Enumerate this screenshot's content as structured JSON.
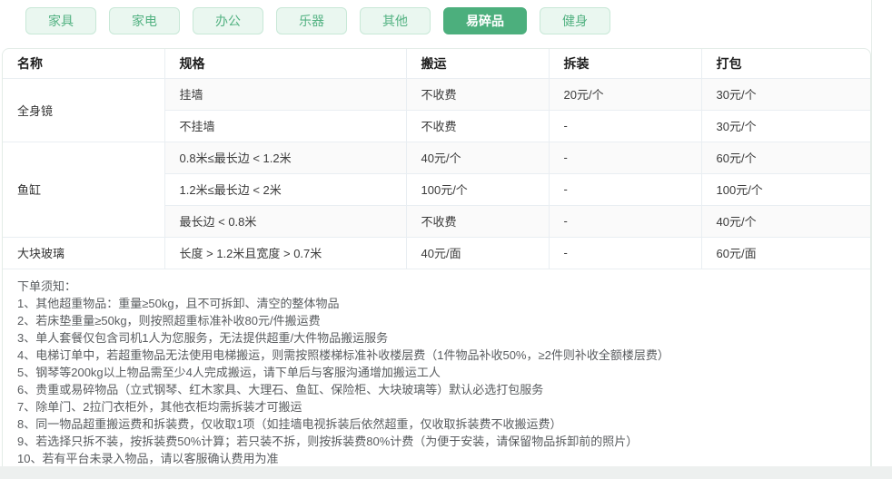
{
  "tabs": [
    {
      "label": "家具",
      "active": false
    },
    {
      "label": "家电",
      "active": false
    },
    {
      "label": "办公",
      "active": false
    },
    {
      "label": "乐器",
      "active": false
    },
    {
      "label": "其他",
      "active": false
    },
    {
      "label": "易碎品",
      "active": true
    },
    {
      "label": "健身",
      "active": false
    }
  ],
  "table": {
    "headers": [
      "名称",
      "规格",
      "搬运",
      "拆装",
      "打包"
    ],
    "groups": [
      {
        "name": "全身镜",
        "rows": [
          {
            "spec": "挂墙",
            "move": "不收费",
            "disassembly": "20元/个",
            "pack": "30元/个"
          },
          {
            "spec": "不挂墙",
            "move": "不收费",
            "disassembly": "-",
            "pack": "30元/个"
          }
        ]
      },
      {
        "name": "鱼缸",
        "rows": [
          {
            "spec": "0.8米≤最长边 < 1.2米",
            "move": "40元/个",
            "disassembly": "-",
            "pack": "60元/个"
          },
          {
            "spec": "1.2米≤最长边 < 2米",
            "move": "100元/个",
            "disassembly": "-",
            "pack": "100元/个"
          },
          {
            "spec": "最长边 < 0.8米",
            "move": "不收费",
            "disassembly": "-",
            "pack": "40元/个"
          }
        ]
      },
      {
        "name": "大块玻璃",
        "rows": [
          {
            "spec": "长度 > 1.2米且宽度 > 0.7米",
            "move": "40元/面",
            "disassembly": "-",
            "pack": "60元/面"
          }
        ]
      }
    ]
  },
  "notes": {
    "title": "下单须知：",
    "items": [
      "1、其他超重物品：重量≥50kg，且不可拆卸、清空的整体物品",
      "2、若床垫重量≥50kg，则按照超重标准补收80元/件搬运费",
      "3、单人套餐仅包含司机1人为您服务，无法提供超重/大件物品搬运服务",
      "4、电梯订单中，若超重物品无法使用电梯搬运，则需按照楼梯标准补收楼层费（1件物品补收50%，≥2件则补收全额楼层费）",
      "5、钢琴等200kg以上物品需至少4人完成搬运，请下单后与客服沟通增加搬运工人",
      "6、贵重或易碎物品（立式钢琴、红木家具、大理石、鱼缸、保险柜、大块玻璃等）默认必选打包服务",
      "7、除单门、2拉门衣柜外，其他衣柜均需拆装才可搬运",
      "8、同一物品超重搬运费和拆装费，仅收取1项（如挂墙电视拆装后依然超重，仅收取拆装费不收搬运费）",
      "9、若选择只拆不装，按拆装费50%计算；若只装不拆，则按拆装费80%计费（为便于安装，请保留物品拆卸前的照片）",
      "10、若有平台未录入物品，请以客服确认费用为准"
    ]
  },
  "colors": {
    "accent_green": "#4caf7d",
    "tab_bg": "#eaf7f0",
    "tab_border": "#c8e8d7",
    "tab_text": "#53b282",
    "table_line": "#e9eef2",
    "card_border": "#e3ece7",
    "stripe": "#fafafa"
  }
}
